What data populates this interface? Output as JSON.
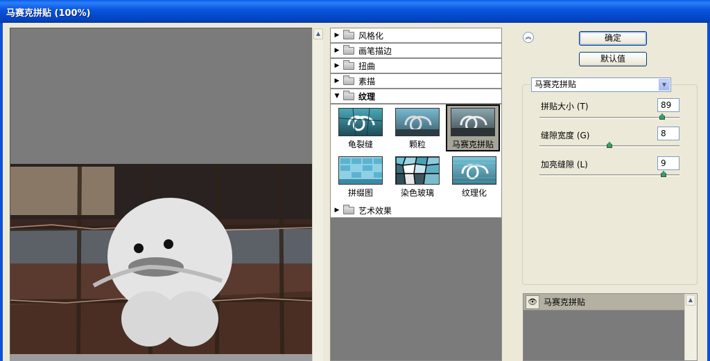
{
  "window": {
    "title": "马赛克拼贴 (100%)"
  },
  "filter_tree": {
    "categories": [
      {
        "label": "风格化",
        "expanded": false
      },
      {
        "label": "画笔描边",
        "expanded": false
      },
      {
        "label": "扭曲",
        "expanded": false
      },
      {
        "label": "素描",
        "expanded": false
      },
      {
        "label": "纹理",
        "expanded": true
      },
      {
        "label": "艺术效果",
        "expanded": false
      }
    ],
    "texture_filters": [
      {
        "label": "龟裂缝",
        "selected": false
      },
      {
        "label": "颗粒",
        "selected": false
      },
      {
        "label": "马赛克拼贴",
        "selected": true
      },
      {
        "label": "拼缀图",
        "selected": false
      },
      {
        "label": "染色玻璃",
        "selected": false
      },
      {
        "label": "纹理化",
        "selected": false
      }
    ]
  },
  "buttons": {
    "ok": "确定",
    "defaults": "默认值"
  },
  "filter_select": {
    "value": "马赛克拼贴"
  },
  "params": [
    {
      "label": "拼贴大小 (T)",
      "value": "89",
      "level_percent": 89
    },
    {
      "label": "缝隙宽度 (G)",
      "value": "8",
      "level_percent": 50
    },
    {
      "label": "加亮缝隙 (L)",
      "value": "9",
      "level_percent": 90
    }
  ],
  "effect_layers": [
    {
      "label": "马赛克拼贴"
    }
  ],
  "colors": {
    "titlebar": "#0a5ee8",
    "dialog_bg": "#ece9d8",
    "preview_bg": "#7b7b7b",
    "slider_knob": "#3f9a64"
  }
}
